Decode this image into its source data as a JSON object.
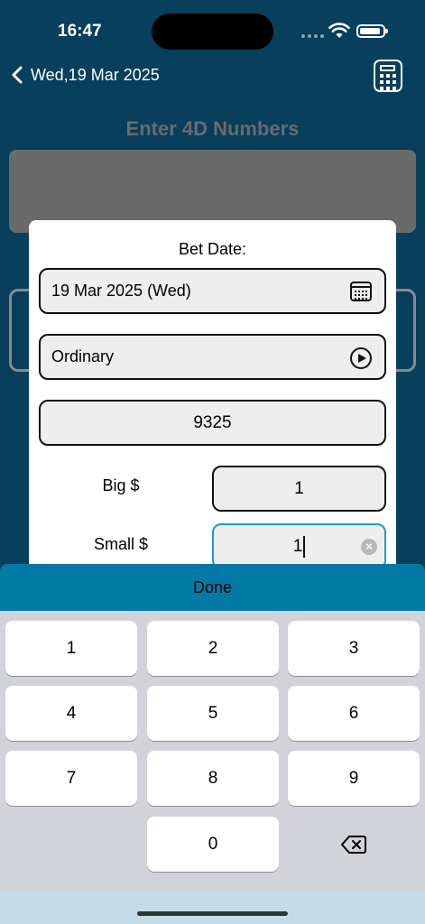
{
  "status": {
    "time": "16:47"
  },
  "nav": {
    "title": "Wed,19 Mar 2025"
  },
  "page": {
    "heading": "Enter 4D Numbers"
  },
  "modal": {
    "bet_date_label": "Bet Date:",
    "date_value": "19 Mar 2025 (Wed)",
    "bet_type": "Ordinary",
    "number": "9325",
    "big_label": "Big $",
    "big_value": "1",
    "small_label": "Small $",
    "small_value": "1"
  },
  "keyboard": {
    "done_label": "Done",
    "keys": [
      "1",
      "2",
      "3",
      "4",
      "5",
      "6",
      "7",
      "8",
      "9",
      "0"
    ]
  },
  "colors": {
    "background": "#073f5c",
    "accessory_bar": "#027aa5",
    "focus_border": "#1a9ad6"
  },
  "icons": [
    "back-chevron-icon",
    "calculator-icon",
    "calendar-icon",
    "play-circle-icon",
    "clear-icon",
    "backspace-icon",
    "wifi-icon",
    "battery-icon"
  ]
}
